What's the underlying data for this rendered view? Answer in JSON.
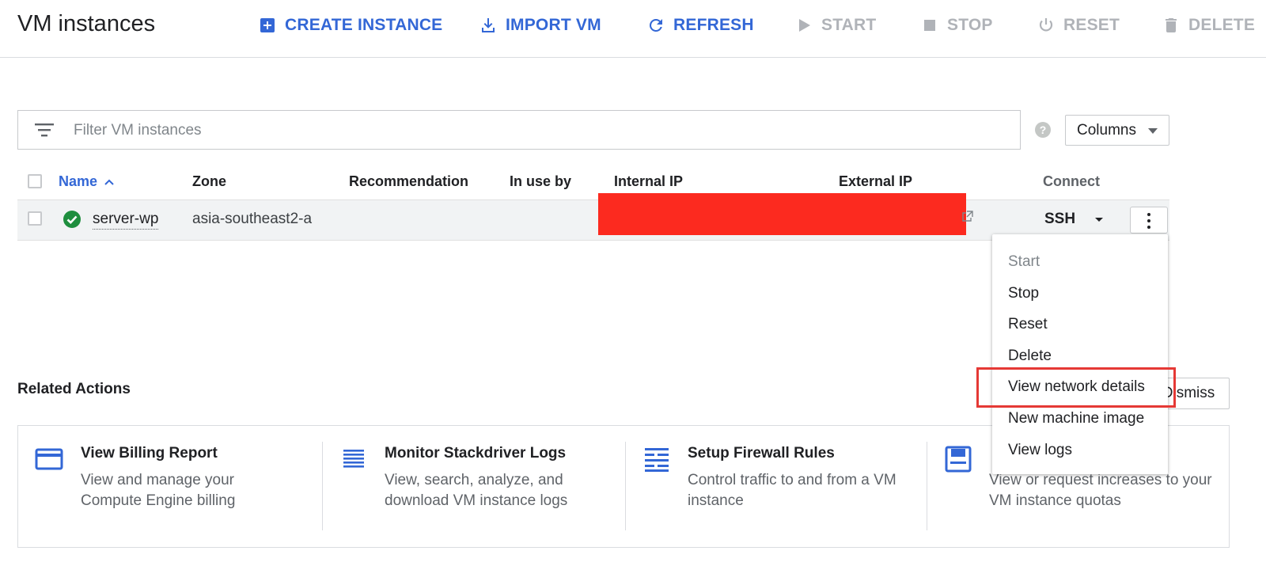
{
  "header": {
    "title": "VM instances",
    "actions": {
      "create": "CREATE INSTANCE",
      "import": "IMPORT VM",
      "refresh": "REFRESH",
      "start": "START",
      "stop": "STOP",
      "reset": "RESET",
      "delete": "DELETE"
    }
  },
  "filter": {
    "placeholder": "Filter VM instances"
  },
  "columns_button": {
    "label": "Columns"
  },
  "table": {
    "headers": {
      "name": "Name",
      "zone": "Zone",
      "recommendation": "Recommendation",
      "in_use_by": "In use by",
      "internal_ip": "Internal IP",
      "external_ip": "External IP",
      "connect": "Connect"
    },
    "rows": [
      {
        "name": "server-wp",
        "zone": "asia-southeast2-a",
        "status": "running",
        "connect": "SSH"
      }
    ]
  },
  "menu": {
    "items": [
      {
        "label": "Start",
        "enabled": false
      },
      {
        "label": "Stop",
        "enabled": true
      },
      {
        "label": "Reset",
        "enabled": true
      },
      {
        "label": "Delete",
        "enabled": true
      },
      {
        "label": "View network details",
        "enabled": true,
        "highlighted": true
      },
      {
        "label": "New machine image",
        "enabled": true
      },
      {
        "label": "View logs",
        "enabled": true
      }
    ]
  },
  "related": {
    "title": "Related Actions",
    "dismiss": "Dismiss",
    "cards": [
      {
        "icon": "credit-card-icon",
        "title": "View Billing Report",
        "desc": "View and manage your Compute Engine billing"
      },
      {
        "icon": "list-lines-icon",
        "title": "Monitor Stackdriver Logs",
        "desc": "View, search, analyze, and download VM instance logs"
      },
      {
        "icon": "firewall-icon",
        "title": "Setup Firewall Rules",
        "desc": "Control traffic to and from a VM instance"
      },
      {
        "icon": "save-icon",
        "title": "",
        "desc": "View or request increases to your VM instance quotas"
      }
    ]
  },
  "colors": {
    "accent": "#3367d6",
    "disabled": "#b0b3b8",
    "running": "#1e8e3e",
    "redaction": "#fc2a1f",
    "highlight_box": "#e53935"
  }
}
